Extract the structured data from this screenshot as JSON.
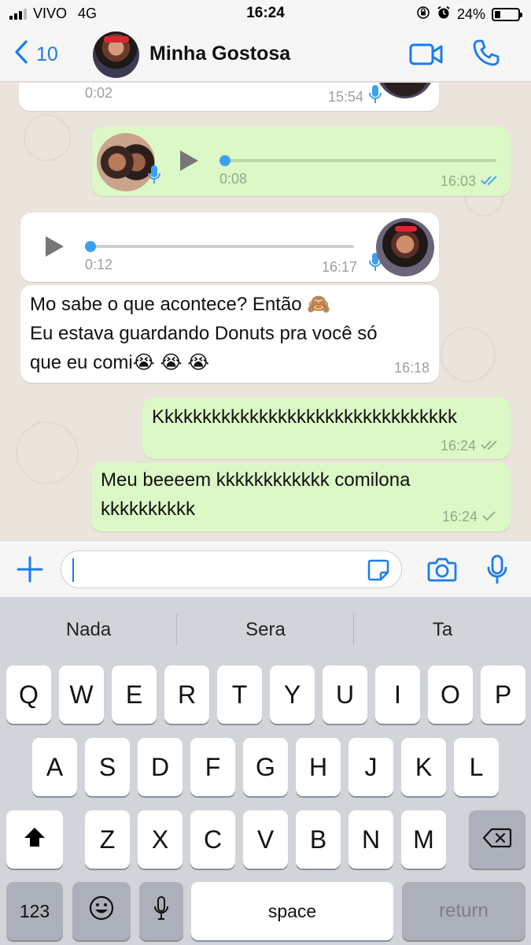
{
  "status_bar": {
    "carrier": "VIVO",
    "network": "4G",
    "time": "16:24",
    "battery": "24%",
    "battery_level": 0.24,
    "signal_bars_active": 3
  },
  "header": {
    "back_count": "10",
    "contact_name": "Minha Gostosa"
  },
  "messages": [
    {
      "direction": "in",
      "type": "voice",
      "duration": "0:02",
      "time": "15:54"
    },
    {
      "direction": "out",
      "type": "voice",
      "duration": "0:08",
      "time": "16:03",
      "ticks": "double",
      "progress": 0
    },
    {
      "direction": "in",
      "type": "voice",
      "duration": "0:12",
      "time": "16:17",
      "progress": 0
    },
    {
      "direction": "in",
      "type": "text",
      "lines": [
        "Mo sabe o que acontece? Então 🙈",
        "Eu estava guardando Donuts pra você só",
        "que eu comi😭 😭 😭"
      ],
      "time": "16:18"
    },
    {
      "direction": "out",
      "type": "text",
      "lines": [
        "Kkkkkkkkkkkkkkkkkkkkkkkkkkkkkkkk"
      ],
      "time": "16:24",
      "ticks": "double"
    },
    {
      "direction": "out",
      "type": "text",
      "lines": [
        "Meu beeeem kkkkkkkkkkkk comilona",
        "kkkkkkkkkk"
      ],
      "time": "16:24",
      "ticks": "single"
    }
  ],
  "colors": {
    "accent": "#1a7cf0",
    "bubble_out": "#dcf8c6",
    "bubble_in": "#ffffff",
    "voice_knob": "#3aa0f4"
  },
  "icons": {
    "back": "chevron-left-icon",
    "video": "video-camera-icon",
    "call": "phone-icon",
    "add": "plus-icon",
    "sticker": "sticker-icon",
    "camera": "camera-icon",
    "mic": "microphone-icon"
  },
  "keyboard": {
    "suggestions": [
      "Nada",
      "Sera",
      "Ta"
    ],
    "row1": [
      "Q",
      "W",
      "E",
      "R",
      "T",
      "Y",
      "U",
      "I",
      "O",
      "P"
    ],
    "row2": [
      "A",
      "S",
      "D",
      "F",
      "G",
      "H",
      "J",
      "K",
      "L"
    ],
    "row3": [
      "Z",
      "X",
      "C",
      "V",
      "B",
      "N",
      "M"
    ],
    "numbers_label": "123",
    "space_label": "space",
    "return_label": "return"
  }
}
